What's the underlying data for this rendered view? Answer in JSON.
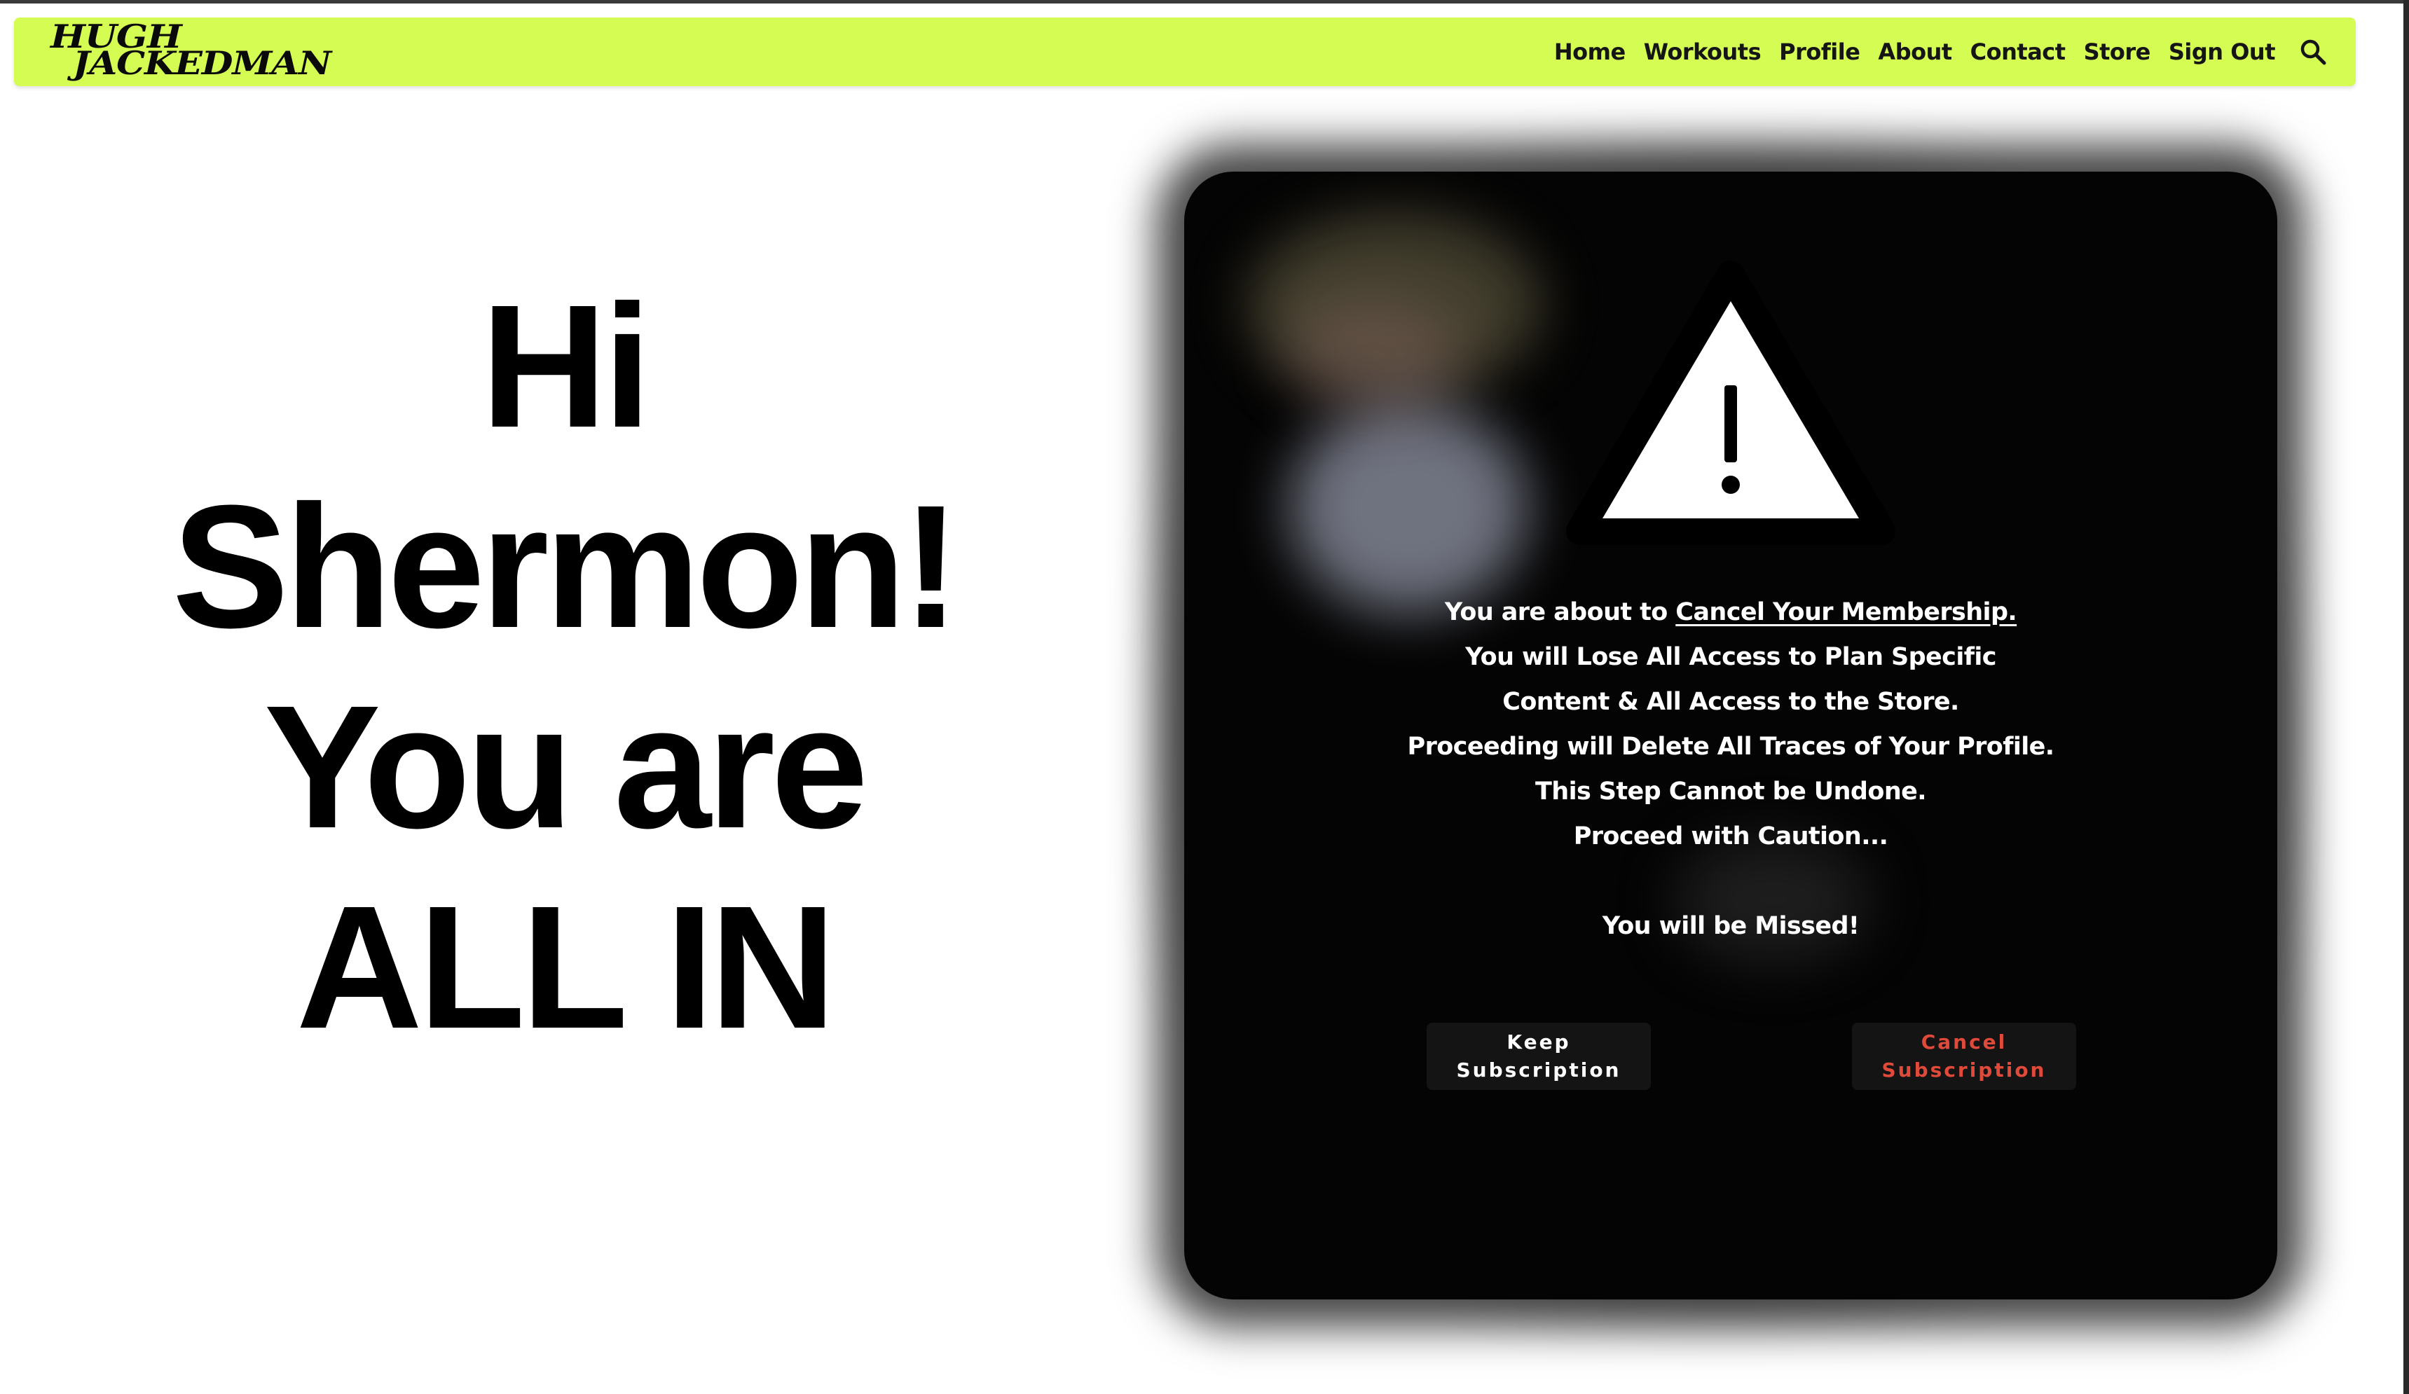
{
  "brand": {
    "logo_line1": "HUGH",
    "logo_line2": "JACKEDMAN",
    "accent_color": "#d4fc53"
  },
  "nav": {
    "items": [
      {
        "label": "Home"
      },
      {
        "label": "Workouts"
      },
      {
        "label": "Profile"
      },
      {
        "label": "About"
      },
      {
        "label": "Contact"
      },
      {
        "label": "Store"
      },
      {
        "label": "Sign Out"
      }
    ],
    "search_icon": "search-icon"
  },
  "greeting": {
    "line1": "Hi",
    "line2": "Shermon!",
    "line3": "You are",
    "line4": "ALL IN"
  },
  "modal": {
    "icon": "warning-icon",
    "intro_prefix": "You are about to ",
    "intro_link": "Cancel Your Membership.",
    "line2": "You will Lose All Access to Plan Specific",
    "line3": "Content & All Access to the Store.",
    "line4": "Proceeding will Delete All Traces of Your Profile.",
    "line5": "This Step Cannot be Undone.",
    "line6": "Proceed with Caution...",
    "line7": "You will be Missed!",
    "keep_button": {
      "line1": "Keep",
      "line2": "Subscription"
    },
    "cancel_button": {
      "line1": "Cancel",
      "line2": "Subscription",
      "color": "#e04a3a"
    }
  }
}
